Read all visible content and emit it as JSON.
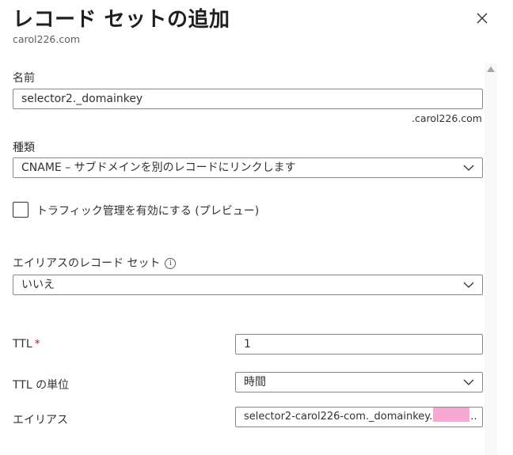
{
  "header": {
    "title": "レコード セットの追加",
    "subtitle": "carol226.com"
  },
  "form": {
    "name": {
      "label": "名前",
      "value": "selector2._domainkey",
      "suffix": ".carol226.com"
    },
    "type": {
      "label": "種類",
      "selected": "CNAME – サブドメインを別のレコードにリンクします"
    },
    "traffic_manager": {
      "label": "トラフィック管理を有効にする (プレビュー)",
      "checked": false
    },
    "alias_record_set": {
      "label": "エイリアスのレコード セット",
      "info_glyph": "i",
      "selected": "いいえ"
    },
    "ttl": {
      "label": "TTL",
      "required_marker": "*",
      "value": "1"
    },
    "ttl_unit": {
      "label": "TTL の単位",
      "selected": "時間"
    },
    "alias": {
      "label": "エイリアス",
      "value_prefix": "selector2-carol226-com._domainkey.",
      "value_suffix": ".."
    }
  },
  "icons": {
    "close": "close-icon",
    "chevron": "chevron-down-icon",
    "info": "info-icon",
    "scroll_up": "scroll-up-arrow-icon"
  },
  "colors": {
    "border": "#8a8886",
    "required": "#a4262c",
    "redaction": "#f7a9d3"
  }
}
